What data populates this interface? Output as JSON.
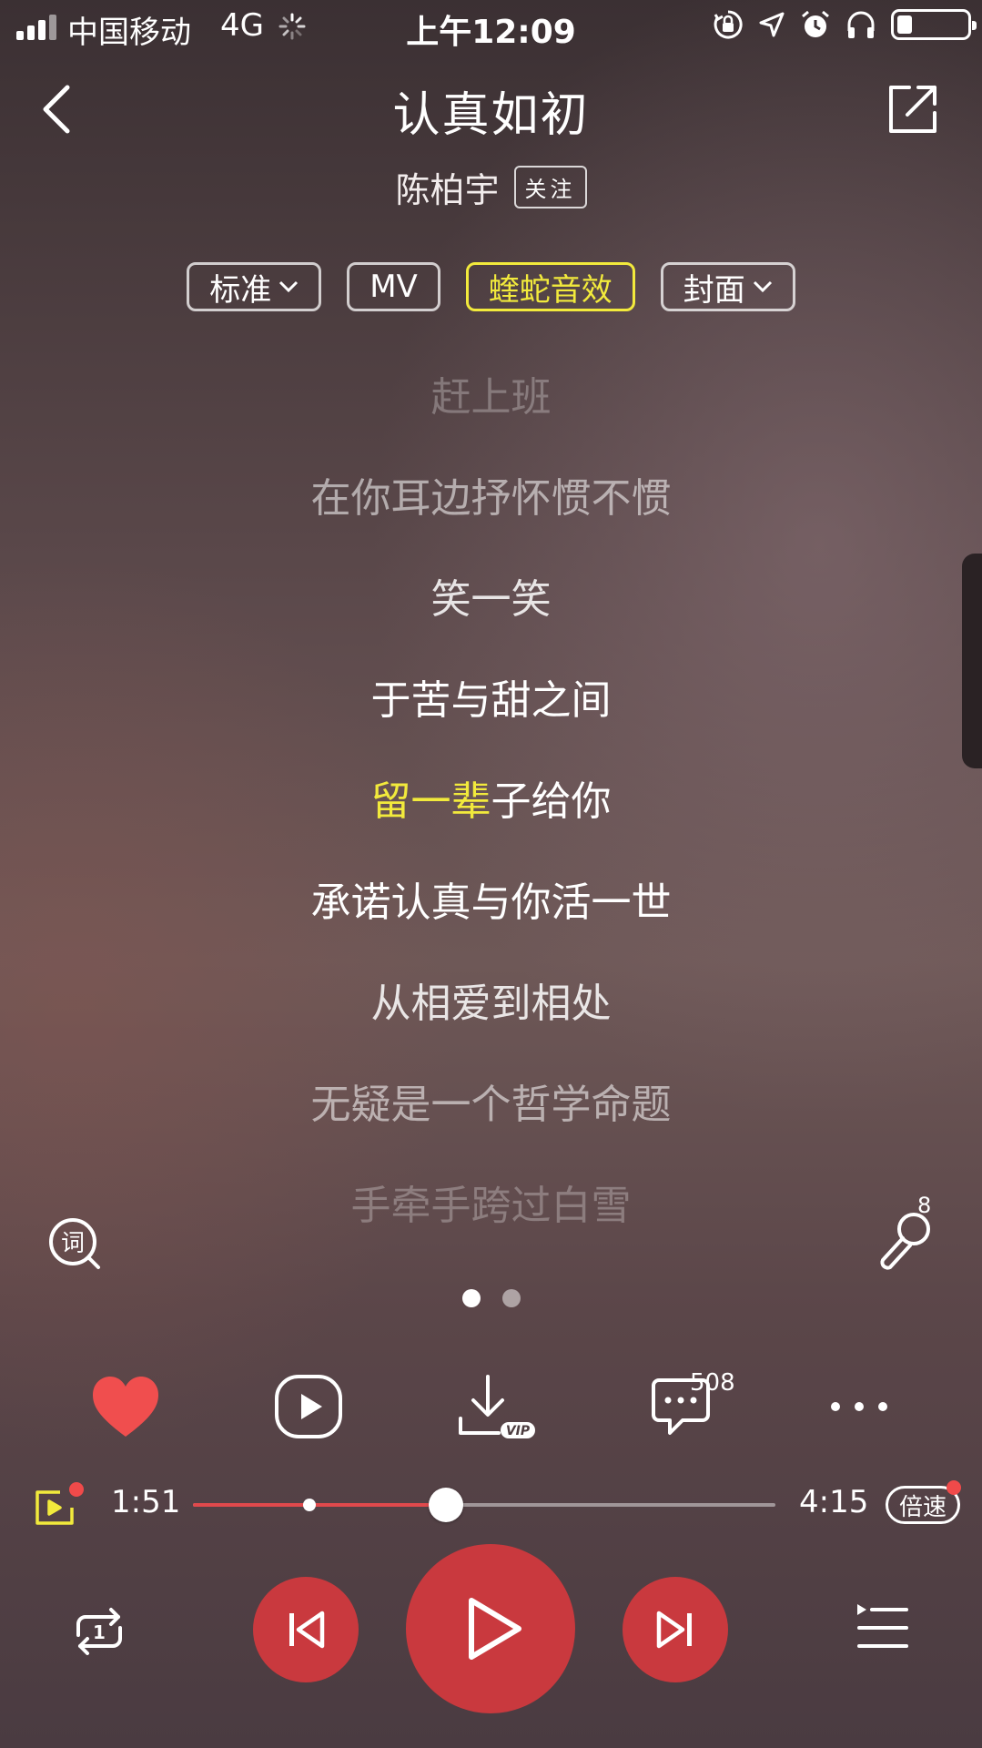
{
  "status_bar": {
    "carrier": "中国移动",
    "network": "4G",
    "time": "上午12:09",
    "icons": [
      "signal-icon",
      "loading-spinner-icon",
      "rotation-lock-icon",
      "location-icon",
      "alarm-icon",
      "headphones-icon",
      "battery-icon"
    ]
  },
  "header": {
    "title": "认真如初",
    "artist": "陈柏宇",
    "follow_label": "关注",
    "back_icon": "chevron-left-icon",
    "share_icon": "share-icon"
  },
  "chips": {
    "quality": "标准",
    "mv": "MV",
    "effect": "蝰蛇音效",
    "cover": "封面",
    "active_color": "#f2ea3c"
  },
  "lyrics": [
    "赶上班",
    "在你耳边抒怀惯不惯",
    "笑一笑",
    "于苦与甜之间",
    "留一辈子给你",
    "承诺认真与你活一世",
    "从相爱到相处",
    "无疑是一个哲学命题",
    "手牵手跨过白雪"
  ],
  "current_lyric": {
    "sung": "留一辈",
    "unsung": "子给你"
  },
  "lyric_tool": {
    "label": "词",
    "mic_count": "8"
  },
  "pager": {
    "pages": 2,
    "current": 1
  },
  "actions": {
    "liked": true,
    "comment_count": "508",
    "download_badge": "VIP"
  },
  "progress": {
    "current_time": "1:51",
    "total_time": "4:15",
    "played_fraction": 0.435,
    "buffered_marker_fraction": 0.2,
    "speed_label": "倍速"
  },
  "controls": {
    "repeat_icon": "repeat-one-icon",
    "repeat_badge": "1",
    "prev_icon": "previous-icon",
    "play_icon": "play-icon",
    "next_icon": "next-icon",
    "playlist_icon": "playlist-icon"
  },
  "colors": {
    "accent_red": "#c9393e",
    "like_red": "#f04e4e",
    "highlight_yellow": "#f2ea3c"
  }
}
